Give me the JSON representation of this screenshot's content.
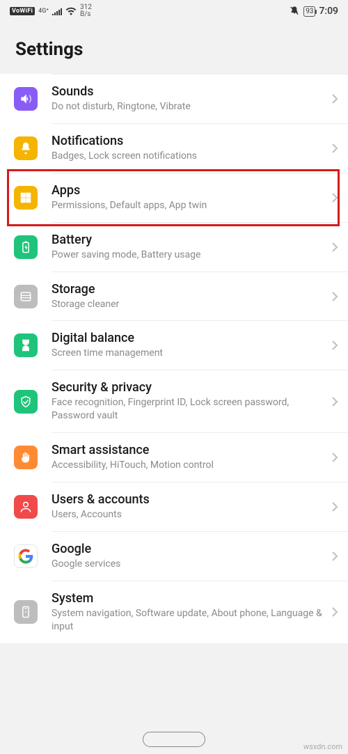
{
  "status": {
    "vowifi": "VoWiFi",
    "net4g": "4G⁺",
    "speed_top": "312",
    "speed_unit": "B/s",
    "battery": "93",
    "clock": "7:09"
  },
  "page": {
    "title": "Settings"
  },
  "rows": [
    {
      "title": "Sounds",
      "sub": "Do not disturb, Ringtone, Vibrate"
    },
    {
      "title": "Notifications",
      "sub": "Badges, Lock screen notifications"
    },
    {
      "title": "Apps",
      "sub": "Permissions, Default apps, App twin"
    },
    {
      "title": "Battery",
      "sub": "Power saving mode, Battery usage"
    },
    {
      "title": "Storage",
      "sub": "Storage cleaner"
    },
    {
      "title": "Digital balance",
      "sub": "Screen time management"
    },
    {
      "title": "Security & privacy",
      "sub": "Face recognition, Fingerprint ID, Lock screen password, Password vault"
    },
    {
      "title": "Smart assistance",
      "sub": "Accessibility, HiTouch, Motion control"
    },
    {
      "title": "Users & accounts",
      "sub": "Users, Accounts"
    },
    {
      "title": "Google",
      "sub": "Google services"
    },
    {
      "title": "System",
      "sub": "System navigation, Software update, About phone, Language & input"
    }
  ],
  "watermark": "wsxdn.com"
}
